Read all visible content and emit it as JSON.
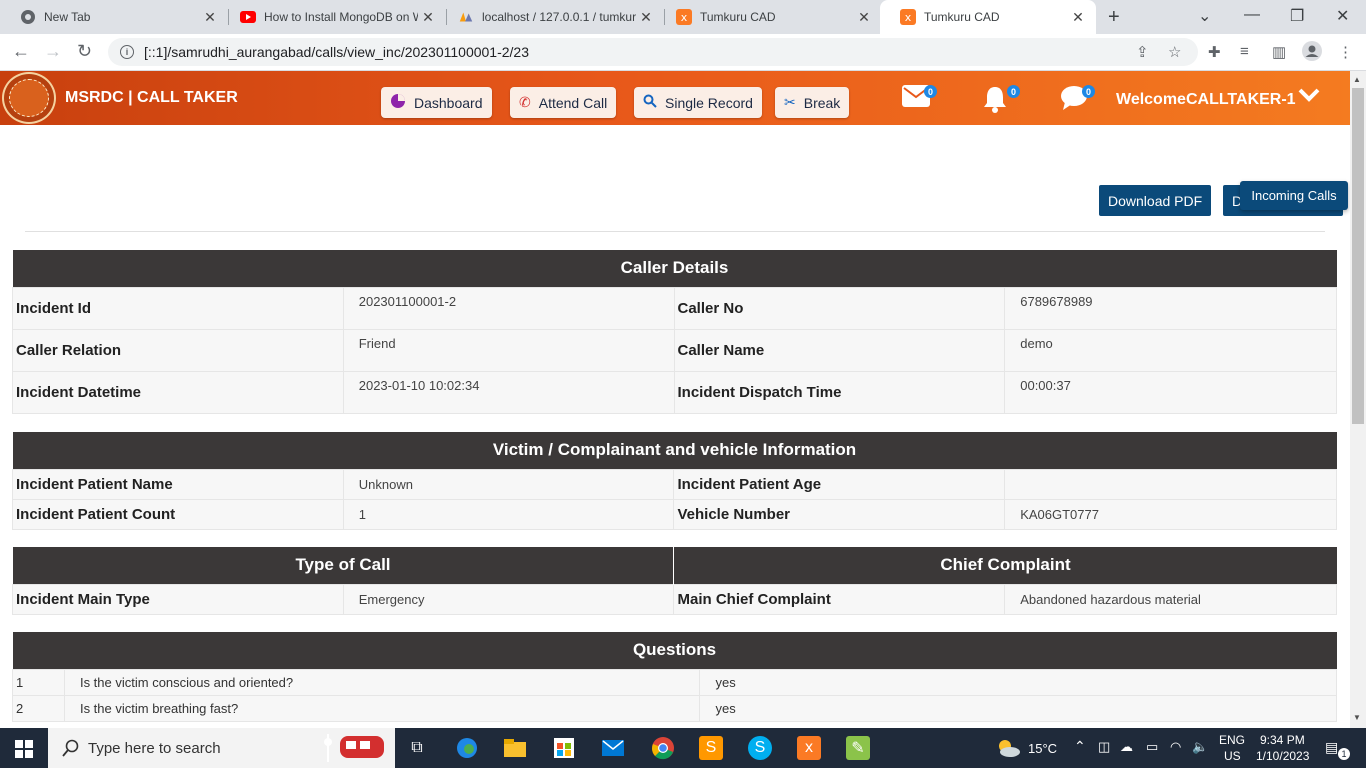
{
  "browser": {
    "tabs": [
      {
        "title": "New Tab",
        "icon": "chrome-icon"
      },
      {
        "title": "How to Install MongoDB on W",
        "icon": "youtube-icon"
      },
      {
        "title": "localhost / 127.0.0.1 / tumkur",
        "icon": "phpmyadmin-icon"
      },
      {
        "title": "Tumkuru CAD",
        "icon": "xampp-icon"
      },
      {
        "title": "Tumkuru CAD",
        "icon": "xampp-icon"
      }
    ],
    "url": "[::1]/samrudhi_aurangabad/calls/view_inc/202301100001-2/23"
  },
  "header": {
    "brand": "MSRDC | CALL TAKER",
    "buttons": {
      "dashboard": "Dashboard",
      "attend_call": "Attend Call",
      "single_record": "Single Record",
      "break": "Break"
    },
    "mail_count": "0",
    "notification_count": "0",
    "chat_count": "0",
    "welcome_prefix": "Welcome",
    "username": "CALLTAKER-1"
  },
  "actions": {
    "download_pdf": "Download PDF",
    "second_button_partial": "D",
    "incoming_calls": "Incoming Calls"
  },
  "caller_details": {
    "title": "Caller Details",
    "rows": [
      {
        "l1": "Incident Id",
        "v1": "202301100001-2",
        "l2": "Caller No",
        "v2": "6789678989"
      },
      {
        "l1": "Caller Relation",
        "v1": "Friend",
        "l2": "Caller Name",
        "v2": "demo"
      },
      {
        "l1": "Incident Datetime",
        "v1": "2023-01-10 10:02:34",
        "l2": "Incident Dispatch Time",
        "v2": "00:00:37"
      }
    ]
  },
  "victim_info": {
    "title": "Victim / Complainant and vehicle Information",
    "rows": [
      {
        "l1": "Incident Patient Name",
        "v1": "Unknown",
        "l2": "Incident Patient Age",
        "v2": ""
      },
      {
        "l1": "Incident Patient Count",
        "v1": "1",
        "l2": "Vehicle Number",
        "v2": "KA06GT0777"
      }
    ]
  },
  "call_type": {
    "title_left": "Type of Call",
    "title_right": "Chief Complaint",
    "l1": "Incident Main Type",
    "v1": "Emergency",
    "l2": "Main Chief Complaint",
    "v2": "Abandoned hazardous material"
  },
  "questions": {
    "title": "Questions",
    "items": [
      {
        "num": "1",
        "question": "Is the victim conscious and oriented?",
        "answer": "yes"
      },
      {
        "num": "2",
        "question": "Is the victim breathing fast?",
        "answer": "yes"
      }
    ]
  },
  "taskbar": {
    "search_placeholder": "Type here to search",
    "temperature": "15°C",
    "language": "ENG",
    "region": "US",
    "time": "9:34 PM",
    "date": "1/10/2023",
    "notification_count": "1"
  },
  "colors": {
    "header_gradient_start": "#c8400e",
    "header_gradient_end": "#f47b20",
    "section_header": "#3b3838",
    "primary_button": "#0b4a7a"
  }
}
